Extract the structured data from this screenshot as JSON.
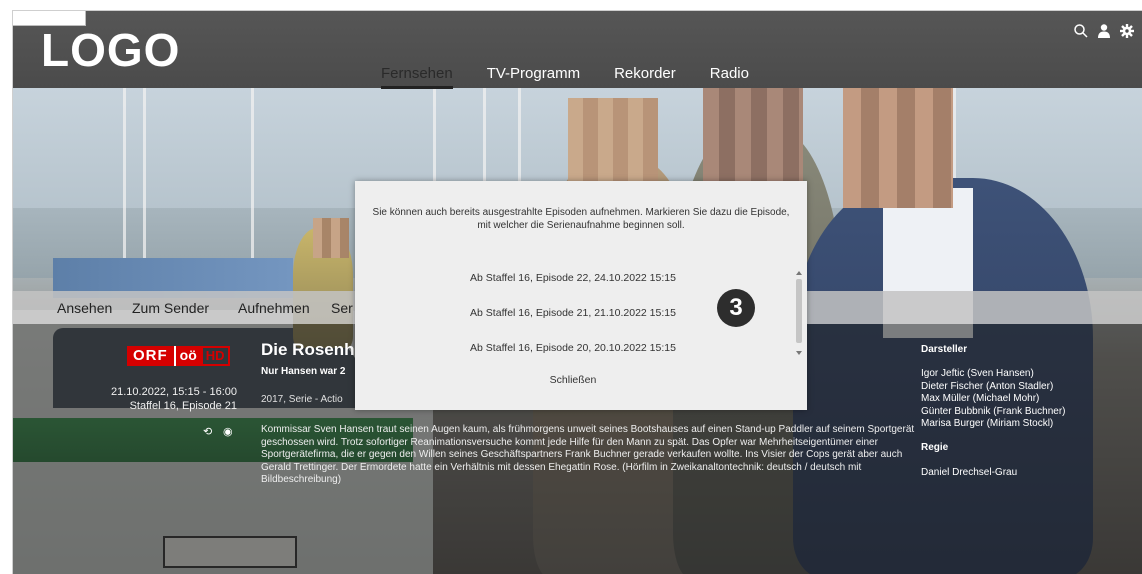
{
  "header": {
    "logo": "LOGO",
    "nav": [
      {
        "label": "Fernsehen",
        "active": true
      },
      {
        "label": "TV-Programm",
        "active": false
      },
      {
        "label": "Rekorder",
        "active": false
      },
      {
        "label": "Radio",
        "active": false
      }
    ],
    "icons": [
      "search-icon",
      "user-icon",
      "gear-icon"
    ]
  },
  "actions": [
    "Ansehen",
    "Zum Sender",
    "Aufnehmen",
    "Ser"
  ],
  "broadcast": {
    "channel": {
      "orf": "ORF",
      "region": "oö",
      "hd": "HD"
    },
    "datetime": "21.10.2022, 15:15 - 16:00",
    "episode": "Staffel 16, Episode 21"
  },
  "show": {
    "title": "Die Rosenh",
    "subtitle": "Nur Hansen war 2",
    "meta": "2017, Serie - Actio",
    "description": "Kommissar Sven Hansen traut seinen Augen kaum, als frühmorgens unweit seines Bootshauses auf einen Stand-up Paddler auf seinem Sportgerät geschossen wird. Trotz sofortiger Reanimationsversuche kommt jede Hilfe für den Mann zu spät. Das Opfer war Mehrheitseigentümer einer Sportgerätefirma, die er gegen den Willen seines Geschäftspartners Frank Buchner gerade verkaufen wollte. Ins Visier der Cops gerät aber auch Gerald Trettinger. Der Ermordete hatte ein Verhältnis mit dessen Ehegattin Rose. (Hörfilm in Zweikanaltontechnik: deutsch / deutsch mit Bildbeschreibung)"
  },
  "cast": {
    "heading": "Darsteller",
    "actors": [
      "Igor Jeftic (Sven Hansen)",
      "Dieter Fischer (Anton Stadler)",
      "Max Müller (Michael Mohr)",
      "Günter Bubbnik (Frank Buchner)",
      "Marisa Burger (Miriam Stockl)"
    ],
    "director_heading": "Regie",
    "director": "Daniel Drechsel-Grau"
  },
  "modal": {
    "message": "Sie können auch bereits ausgestrahlte Episoden aufnehmen. Markieren Sie dazu die Episode, mit welcher die Serienaufnahme beginnen soll.",
    "options": [
      "Ab Staffel 16, Episode 22, 24.10.2022 15:15",
      "Ab Staffel 16, Episode 21, 21.10.2022 15:15",
      "Ab Staffel 16, Episode 20, 20.10.2022 15:15"
    ],
    "close_label": "Schließen",
    "step_badge": "3"
  }
}
